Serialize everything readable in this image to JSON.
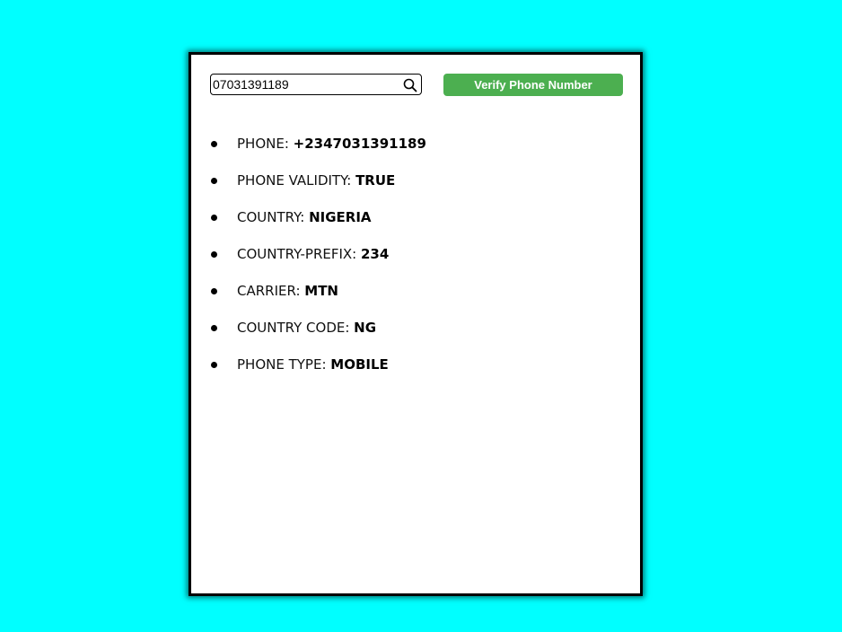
{
  "search": {
    "value": "07031391189",
    "icon": "search-icon"
  },
  "verify_button_label": "Verify Phone Number",
  "results": [
    {
      "label": "PHONE: ",
      "value": "+2347031391189"
    },
    {
      "label": "PHONE VALIDITY: ",
      "value": "TRUE"
    },
    {
      "label": "COUNTRY: ",
      "value": "NIGERIA"
    },
    {
      "label": "COUNTRY-PREFIX: ",
      "value": "234"
    },
    {
      "label": "CARRIER: ",
      "value": "MTN"
    },
    {
      "label": "COUNTRY CODE: ",
      "value": "NG"
    },
    {
      "label": "PHONE TYPE: ",
      "value": "MOBILE"
    }
  ],
  "colors": {
    "background": "#00ffff",
    "button": "#4caf50",
    "button_text": "#ffffff"
  }
}
